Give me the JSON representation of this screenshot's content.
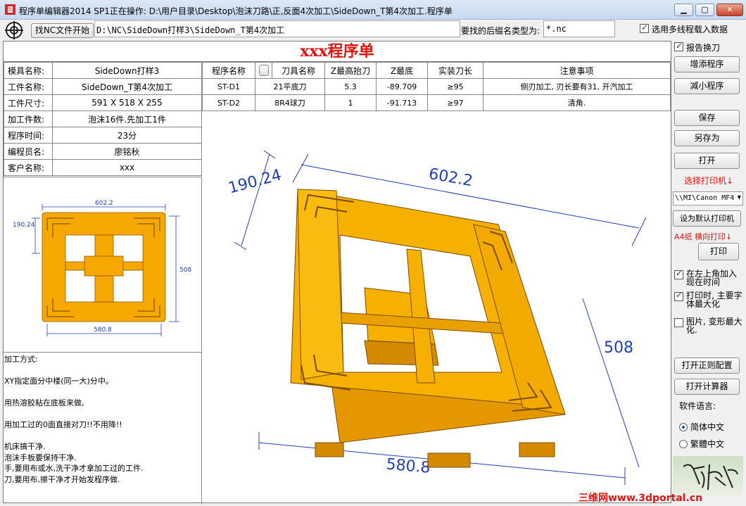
{
  "window": {
    "title": "程序单编辑器2014 SP1正在操作: D:\\用户目录\\Desktop\\泡沫刀路\\正,反面4次加工\\SideDown_T第4次加工.程序单"
  },
  "toolbar": {
    "find_nc_label": "找NC文件开始",
    "path_value": "D:\\NC\\SideDown打样3\\SideDown_T第4次加工",
    "ext_label": "要找的后缀名类型为:",
    "ext_value": "*.nc",
    "multi_load_label": "选用多线程载入数据"
  },
  "doc": {
    "title": "xxx程序单",
    "info": [
      {
        "key": "模具名称:",
        "value": "SideDown打样3"
      },
      {
        "key": "工件名称:",
        "value": "SideDown_T第4次加工"
      },
      {
        "key": "工件尺寸:",
        "value": "591 X 518 X 255"
      },
      {
        "key": "加工件数:",
        "value": "泡沫16件.先加工1件"
      },
      {
        "key": "程序时间:",
        "value": "23分"
      },
      {
        "key": "编程员名:",
        "value": "廖铭秋"
      },
      {
        "key": "客户名称:",
        "value": "xxx"
      }
    ],
    "notes": "加工方式:\n\nXY指定面分中楼(同一大)分中。\n\n用热溶胶粘在底板来做,\n\n用加工过的0面直接对刀!!不用降!!\n\n机床搞干净.\n泡沫手板要保持干净.\n手,要用布或水,洗干净才拿加工过的工件.\n刀,要用布,擦干净才开始发程序做.",
    "columns": [
      "程序名称",
      "刀具名称",
      "Z最高抬刀",
      "Z最底",
      "实装刀长",
      "注意事项"
    ],
    "rows": [
      [
        "ST-D1",
        "21平底刀",
        "5.3",
        "-89.709",
        "≥95",
        "侧刃加工, 刃长要有31, 开汽加工"
      ],
      [
        "ST-D2",
        "8R4球刀",
        "1",
        "-91.713",
        "≥97",
        "清角."
      ]
    ],
    "dims": {
      "top": "602.2",
      "left": "190.24",
      "right": "508",
      "bottom": "580.8"
    }
  },
  "right_panel": {
    "report_wrap": "报告换刀",
    "add_program": "增添程序",
    "remove_program": "减小程序",
    "save": "保存",
    "save_as": "另存为",
    "open": "打开",
    "select_printer": "选择打印机↓",
    "printer_value": "\\\\MI\\Canon MF4",
    "set_default_printer": "设为默认打印机",
    "paper_label": "A4纸 横向打印↓",
    "print": "打印",
    "opt_time": "在左上角加入现在时间",
    "opt_maxfont": "打印时, 主要字体最大化",
    "opt_picture": "图片, 变形最大化.",
    "open_regex": "打开正则配置",
    "open_calc": "打开计算器",
    "lang_label": "软件语言:",
    "lang_simplified": "简体中文",
    "lang_traditional": "繁體中文"
  },
  "watermark": "三维网www.3dportal.cn",
  "colors": {
    "accent_red": "#e0140e",
    "part_orange": "#f6a700",
    "dim_blue": "#1f3fb8"
  }
}
